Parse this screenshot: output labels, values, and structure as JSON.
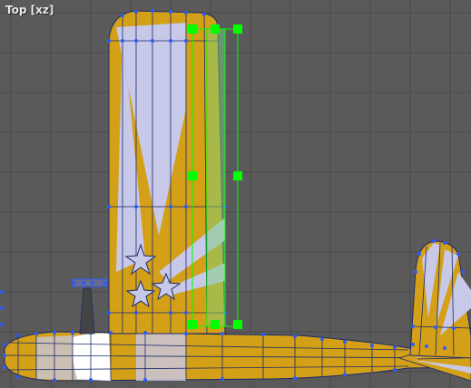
{
  "viewport": {
    "label": "Top [xz]",
    "background_color": "#5a5a5a",
    "grid_color": "#4a4a4a",
    "selection_color": "#00ff00",
    "wire_color": "#1a2a6a",
    "vertex_color": "#2a5bff"
  },
  "model": {
    "texture_colors": {
      "gold": "#d4a017",
      "lavender": "#c8c8e8",
      "white": "#ffffff"
    }
  },
  "icons": {
    "handle": "square-handle-icon",
    "vertex": "vertex-dot-icon",
    "star": "star-icon"
  }
}
